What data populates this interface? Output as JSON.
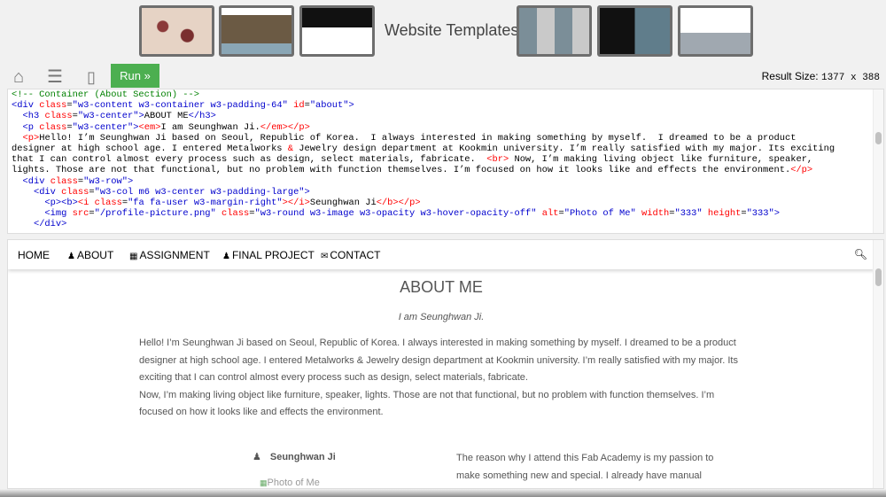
{
  "banner": {
    "title": "Website Templates",
    "thumbnails": [
      "pizza-template",
      "city-template",
      "built-with-w3css-template",
      "photo-grid-template",
      "profile-template",
      "architecture-template"
    ]
  },
  "toolbar": {
    "home_icon": "home-icon",
    "menu_icon": "menu-icon",
    "rotate_icon": "rotate-icon",
    "run_label": "Run »",
    "result_size_label": "Result Size:",
    "result_size_value": "1377 x 388"
  },
  "code_lines": [
    "<!-- Container (About Section) -->",
    "<div class=\"w3-content w3-container w3-padding-64\" id=\"about\">",
    "  <h3 class=\"w3-center\">ABOUT ME</h3>",
    "  <p class=\"w3-center\"><em>I am Seunghwan Ji.</em></p>",
    "  <p>Hello! I’m Seunghwan Ji based on Seoul, Republic of Korea.  I always interested in making something by myself.  I dreamed to be a product",
    "designer at high school age. I entered Metalworks & Jewelry design department at Kookmin university. I’m really satisfied with my major. Its exciting",
    "that I can control almost every process such as design, select materials, fabricate.  <br> Now, I’m making living object like furniture, speaker,",
    "lights. Those are not that functional, but no problem with function themselves. I’m focused on how it looks like and effects the environment.</p>",
    "  <div class=\"w3-row\">",
    "    <div class=\"w3-col m6 w3-center w3-padding-large\">",
    "      <p><b><i class=\"fa fa-user w3-margin-right\"></i>Seunghwan Ji</b></p>",
    "      <img src=\"/profile-picture.png\" class=\"w3-round w3-image w3-opacity w3-hover-opacity-off\" alt=\"Photo of Me\" width=\"333\" height=\"333\">",
    "    </div>"
  ],
  "result": {
    "nav": [
      {
        "label": "HOME",
        "icon": ""
      },
      {
        "label": "ABOUT",
        "icon": "user-icon"
      },
      {
        "label": "ASSIGNMENT",
        "icon": "th-icon"
      },
      {
        "label": "FINAL PROJECT",
        "icon": "user-icon"
      },
      {
        "label": "CONTACT",
        "icon": "envelope-icon"
      }
    ],
    "search_icon": "search-icon",
    "about_title": "ABOUT ME",
    "about_subtitle": "I am Seunghwan Ji.",
    "about_paragraph_1": "Hello! I’m Seunghwan Ji based on Seoul, Republic of Korea. I always interested in making something by myself. I dreamed to be a product designer at high school age. I entered Metalworks & Jewelry design department at Kookmin university. I’m really satisfied with my major. Its exciting that I can control almost every process such as design, select materials, fabricate.",
    "about_paragraph_2": "Now, I’m making living object like furniture, speaker, lights. Those are not that functional, but no problem with function themselves. I’m focused on how it looks like and effects the environment.",
    "profile_name": "Seunghwan Ji",
    "photo_alt": "Photo of Me",
    "reason_text": "The reason why I attend this Fab Academy is my passion to make something new and special. I already have manual fabrication"
  },
  "colors": {
    "run_button": "#4caf50",
    "code_tag": "#0000cd",
    "code_attr": "#ff0000",
    "code_comment": "#008000"
  }
}
